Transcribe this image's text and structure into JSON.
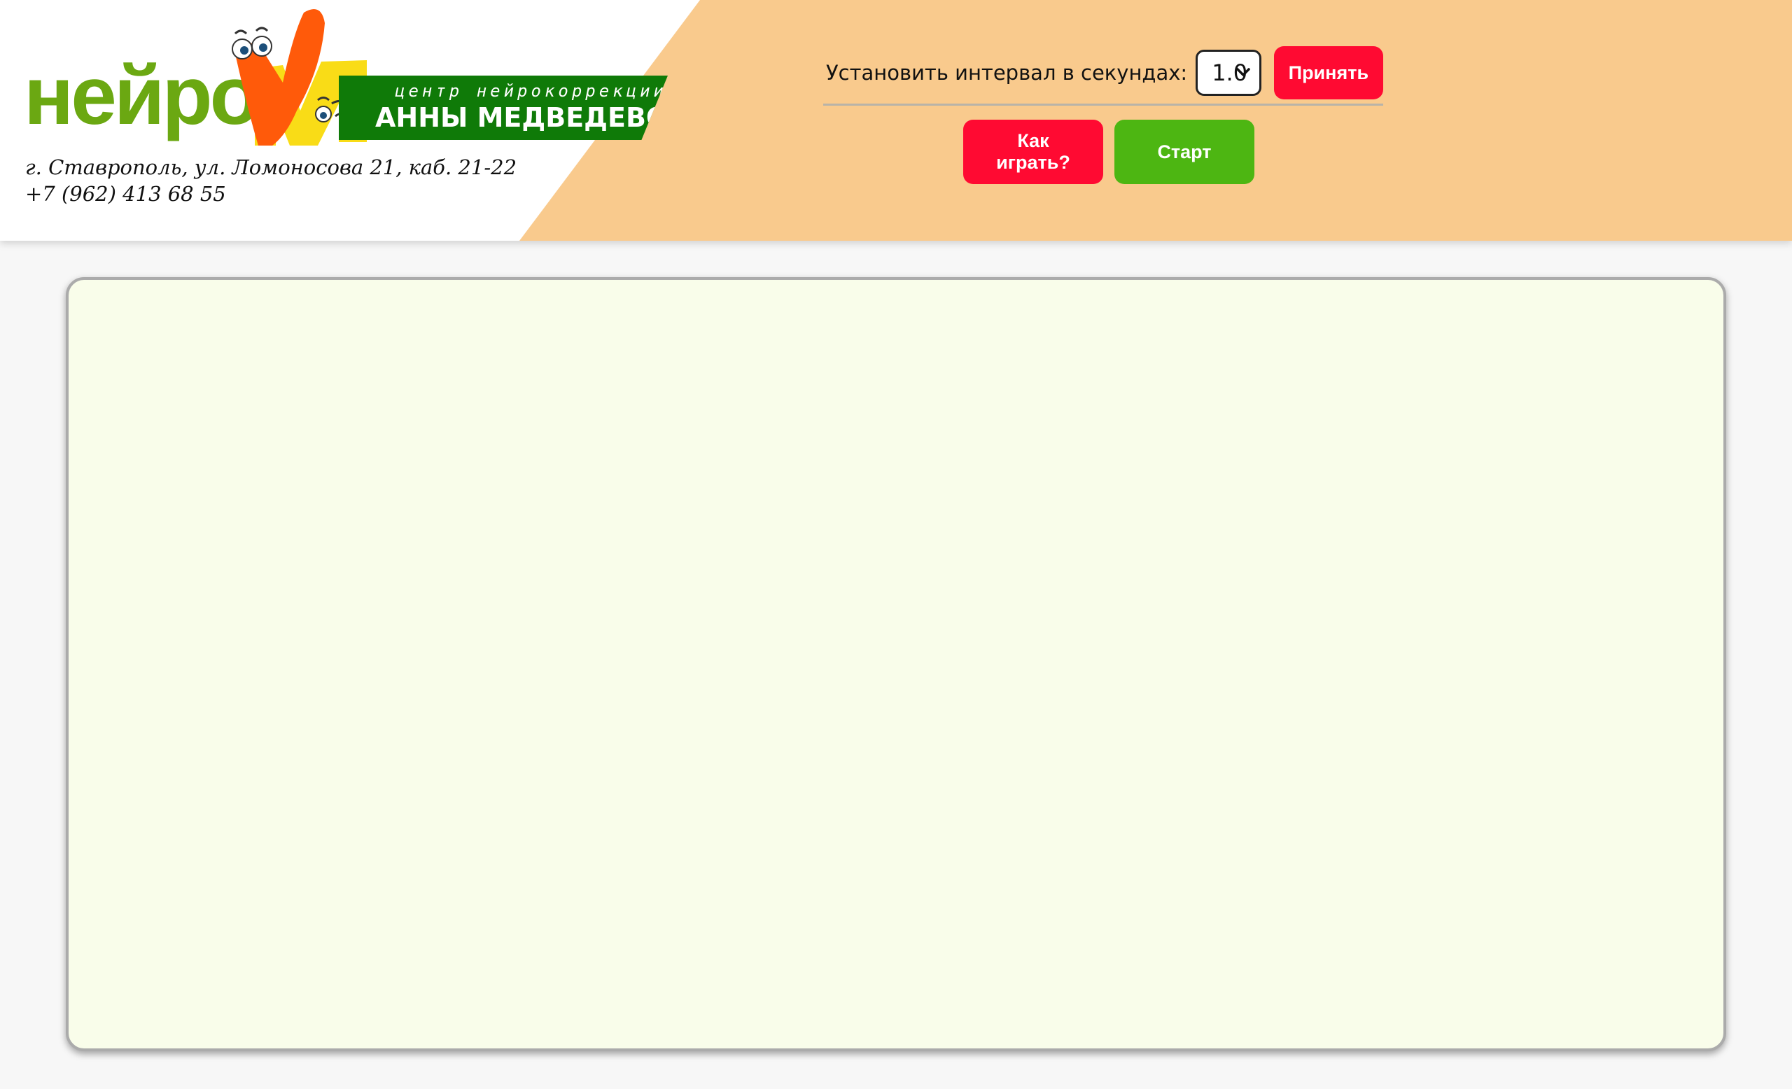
{
  "brand": {
    "logo_word": "нейро",
    "logo_letter": "М",
    "banner_top": "центр нейрокоррекции",
    "banner_main": "АННЫ МЕДВЕДЕВОЙ",
    "address": "г. Ставрополь, ул. Ломоносова 21, каб. 21-22",
    "phone": "+7 (962) 413 68 55"
  },
  "controls": {
    "interval_label": "Установить интервал в секундах:",
    "interval_value": "1.0",
    "accept_label": "Принять",
    "how_to_play_line1": "Как",
    "how_to_play_line2": "играть?",
    "start_label": "Старт"
  },
  "colors": {
    "header_accent": "#f9ca8d",
    "logo_green": "#6ba812",
    "banner_green": "#0f7a08",
    "accept_red": "#ff0a32",
    "start_green": "#4db612",
    "game_area_bg": "#f9fdea"
  },
  "icons": {
    "select_arrow": "chevron-down-icon",
    "mascot": "mascot-logo-icon"
  }
}
